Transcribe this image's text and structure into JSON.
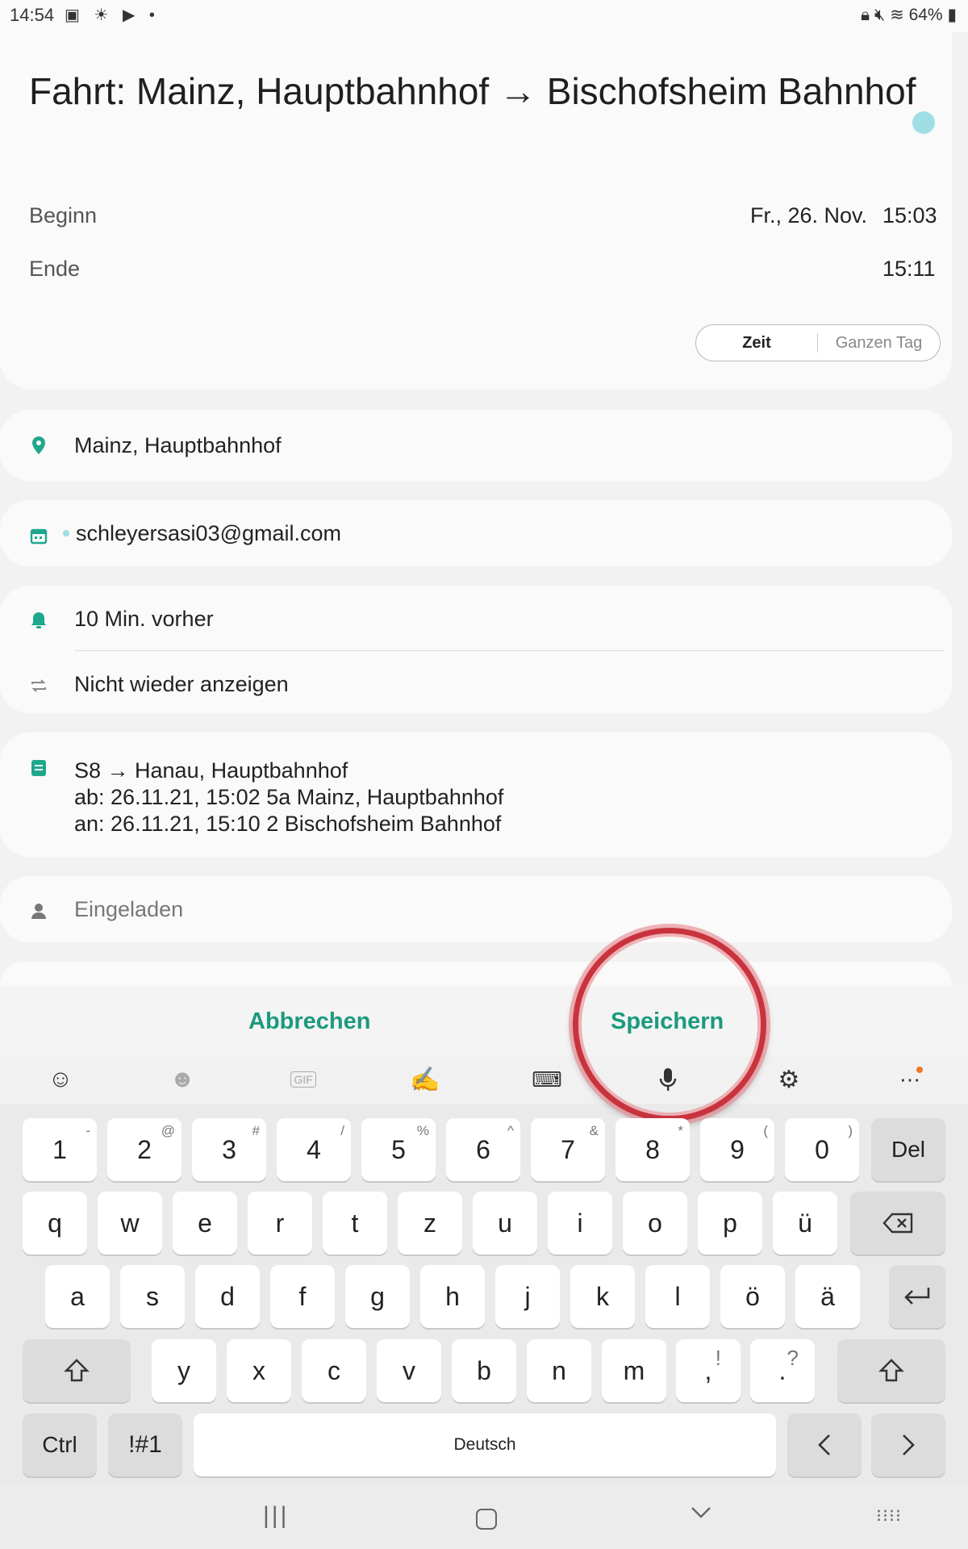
{
  "status_bar": {
    "time": "14:54",
    "battery": "64%"
  },
  "event": {
    "title": "Fahrt: Mainz, Hauptbahnhof → Bischofsheim Bahnhof",
    "color": "#9fdfe3",
    "begin_label": "Beginn",
    "begin_date": "Fr., 26. Nov.",
    "begin_time": "15:03",
    "end_label": "Ende",
    "end_time": "15:11",
    "mode_time": "Zeit",
    "mode_allday": "Ganzen Tag"
  },
  "location": {
    "value": "Mainz, Hauptbahnhof",
    "icon": "location-pin-icon"
  },
  "calendar": {
    "value": "schleyersasi03@gmail.com",
    "icon": "calendar-icon"
  },
  "reminder": {
    "value": "10 Min. vorher",
    "icon": "bell-icon"
  },
  "repeat": {
    "value": "Nicht wieder anzeigen",
    "icon": "repeat-icon"
  },
  "notes": {
    "line1": "S8 → Hanau, Hauptbahnhof",
    "line2": "ab: 26.11.21, 15:02 5a Mainz, Hauptbahnhof",
    "line3": "an: 26.11.21, 15:10 2 Bischofsheim Bahnhof",
    "icon": "note-icon"
  },
  "invited": {
    "placeholder": "Eingeladen",
    "icon": "person-icon"
  },
  "actions": {
    "cancel": "Abbrechen",
    "save": "Speichern"
  },
  "keyboard": {
    "toolbar": [
      "emoji-icon",
      "sticker-icon",
      "gif-icon",
      "handwriting-icon",
      "keyboard-layout-icon",
      "microphone-icon",
      "settings-icon",
      "more-icon"
    ],
    "number_row": [
      {
        "k": "1",
        "s": "-"
      },
      {
        "k": "2",
        "s": "@"
      },
      {
        "k": "3",
        "s": "#"
      },
      {
        "k": "4",
        "s": "/"
      },
      {
        "k": "5",
        "s": "%"
      },
      {
        "k": "6",
        "s": "^"
      },
      {
        "k": "7",
        "s": "&"
      },
      {
        "k": "8",
        "s": "*"
      },
      {
        "k": "9",
        "s": "("
      },
      {
        "k": "0",
        "s": ")"
      }
    ],
    "del": "Del",
    "row_q": [
      "q",
      "w",
      "e",
      "r",
      "t",
      "z",
      "u",
      "i",
      "o",
      "p",
      "ü"
    ],
    "row_a": [
      "a",
      "s",
      "d",
      "f",
      "g",
      "h",
      "j",
      "k",
      "l",
      "ö",
      "ä"
    ],
    "row_y": [
      "y",
      "x",
      "c",
      "v",
      "b",
      "n",
      "m"
    ],
    "comma": ",",
    "comma_sup": "!",
    "period": ".",
    "period_sup": "?",
    "ctrl": "Ctrl",
    "symbols": "!#1",
    "space": "Deutsch"
  }
}
